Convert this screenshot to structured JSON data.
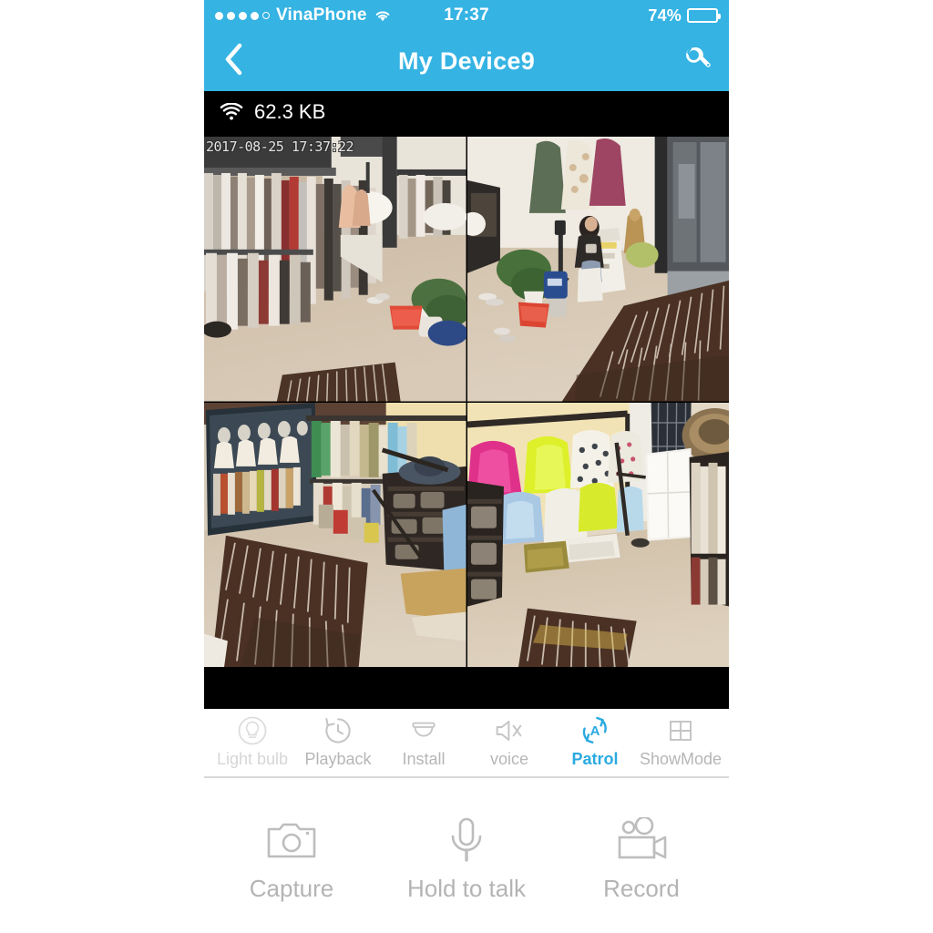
{
  "status_bar": {
    "signal_dots_filled": 4,
    "signal_dots_empty": 1,
    "carrier": "VinaPhone",
    "wifi_icon": "wifi-icon",
    "time": "17:37",
    "battery_percent": "74%",
    "battery_level": 74
  },
  "nav_bar": {
    "back_icon": "chevron-left-icon",
    "title": "My Device9",
    "settings_icon": "wrench-icon"
  },
  "bandwidth": {
    "wifi_icon": "wifi-icon",
    "rate": "62.3 KB"
  },
  "video": {
    "timestamp": "2017-08-25 17:37:22",
    "layout": "2x2",
    "cameras": [
      {
        "id": "cam1",
        "scene": "clothing-store-racks-left"
      },
      {
        "id": "cam2",
        "scene": "store-counter-with-person"
      },
      {
        "id": "cam3",
        "scene": "storefront-glass-hanger-rows"
      },
      {
        "id": "cam4",
        "scene": "colorful-apparel-aisle"
      }
    ]
  },
  "toolbar": {
    "items": [
      {
        "label": "Light bulb",
        "icon": "light-bulb-icon",
        "state": "disabled"
      },
      {
        "label": "Playback",
        "icon": "playback-clock-icon",
        "state": "normal"
      },
      {
        "label": "Install",
        "icon": "dome-camera-icon",
        "state": "normal"
      },
      {
        "label": "voice",
        "icon": "speaker-muted-icon",
        "state": "normal"
      },
      {
        "label": "Patrol",
        "icon": "auto-patrol-icon",
        "state": "active"
      },
      {
        "label": "ShowMode",
        "icon": "grid-four-icon",
        "state": "normal"
      }
    ],
    "active_color": "#2aaae0",
    "inactive_color": "#b6b6b6"
  },
  "actions": [
    {
      "label": "Capture",
      "icon": "camera-icon"
    },
    {
      "label": "Hold to talk",
      "icon": "microphone-icon"
    },
    {
      "label": "Record",
      "icon": "video-camera-icon"
    }
  ],
  "colors": {
    "brand_blue": "#35b3e3",
    "accent_blue": "#2aaae0",
    "video_background": "#000000",
    "page_background": "#ffffff"
  }
}
